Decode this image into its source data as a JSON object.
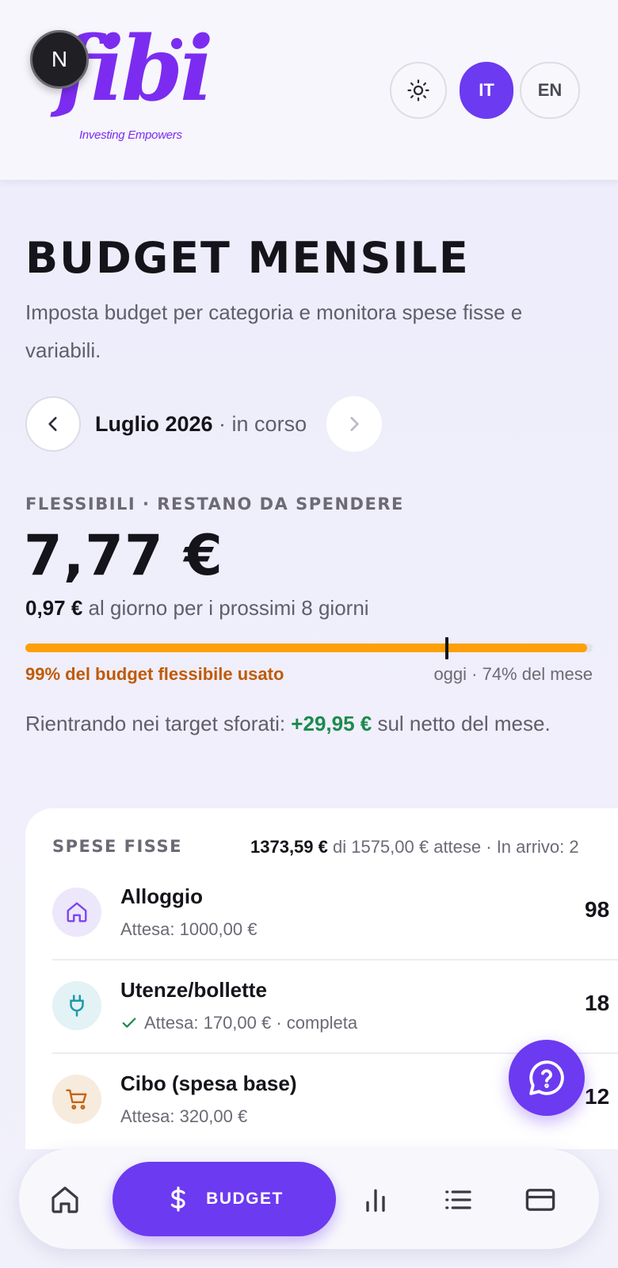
{
  "header": {
    "logo_text": "fibi",
    "logo_tagline": "Investing Empowers",
    "n_badge": "N",
    "theme_icon": "sun-icon",
    "lang_active": "IT",
    "lang_other": "EN"
  },
  "page": {
    "title": "BUDGET MENSILE",
    "subtitle": "Imposta budget per categoria e monitora spese fisse e variabili."
  },
  "month_nav": {
    "month": "Luglio 2026",
    "status": " · in corso",
    "prev_icon": "chevron-left-icon",
    "next_icon": "chevron-right-icon"
  },
  "flex": {
    "kicker": "FLESSIBILI · RESTANO DA SPENDERE",
    "remaining": "7,77 €",
    "per_day_amount": "0,97 €",
    "per_day_text": " al giorno per i prossimi 8 giorni",
    "budget_used_fraction": 0.99,
    "month_elapsed_fraction": 0.74,
    "budget_used_label": "99% del budget flessibile usato",
    "today_label": "oggi · 74% del mese",
    "note_prefix": "Rientrando nei target sforati: ",
    "note_amount": "+29,95 €",
    "note_suffix": " sul netto del mese."
  },
  "fixed": {
    "heading": "SPESE FISSE",
    "summary_amount": "1373,59 €",
    "summary_text": " di 1575,00 € attese · In arrivo: 2",
    "items": [
      {
        "name": "Alloggio",
        "expected": "Attesa: 1000,00 €",
        "status": "",
        "value": "98",
        "icon": "home-icon"
      },
      {
        "name": "Utenze/bollette",
        "expected": "Attesa: 170,00 €",
        "status": " · completa",
        "value": "18",
        "icon": "plug-icon"
      },
      {
        "name": "Cibo (spesa base)",
        "expected": "Attesa: 320,00 €",
        "status": "",
        "value": "12",
        "icon": "cart-icon"
      }
    ]
  },
  "bottom_nav": {
    "active_label": "BUDGET",
    "items": [
      "home-icon",
      "dollar-icon",
      "bar-chart-icon",
      "list-icon",
      "card-icon"
    ]
  },
  "colors": {
    "accent": "#6c3af0",
    "brand": "#7c2cf0",
    "progress": "#ff9f0a",
    "warning_text": "#c15a06",
    "positive": "#1b8a4e"
  }
}
